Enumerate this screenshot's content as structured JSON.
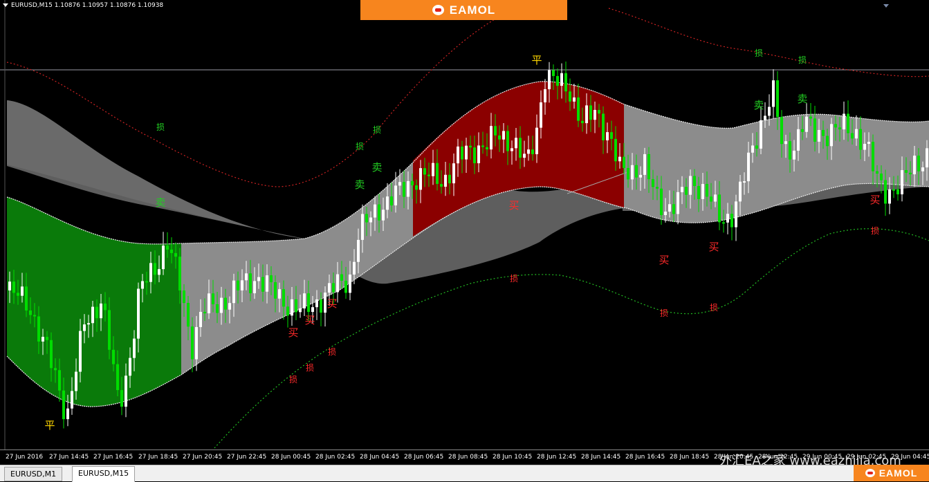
{
  "window": {
    "symbol_title": "EURUSD,M15  1.10876 1.10957 1.10876 1.10938"
  },
  "brand": {
    "banner_text": "EAMOL",
    "banner_color": "#f7851e",
    "footer_text": "EAMOL"
  },
  "watermark": "外汇EA之家  www.eazhijia.com",
  "tabs": [
    {
      "label": "EURUSD,M1",
      "active": false
    },
    {
      "label": "EURUSD,M15",
      "active": true
    }
  ],
  "time_axis": [
    "27 Jun 2016",
    "27 Jun 14:45",
    "27 Jun 16:45",
    "27 Jun 18:45",
    "27 Jun 20:45",
    "27 Jun 22:45",
    "28 Jun 00:45",
    "28 Jun 02:45",
    "28 Jun 04:45",
    "28 Jun 06:45",
    "28 Jun 08:45",
    "28 Jun 10:45",
    "28 Jun 12:45",
    "28 Jun 14:45",
    "28 Jun 16:45",
    "28 Jun 18:45",
    "28 Jun 20:45",
    "28 Jun 22:45",
    "29 Jun 00:45",
    "29 Jun 02:45",
    "29 Jun 04:45"
  ],
  "colors": {
    "background": "#000000",
    "candle_up": "#ffffff",
    "candle_down": "#00dd00",
    "bull_zone": "#0a7a0a",
    "bear_zone": "#8b0000",
    "band": "#8c8c8c",
    "band_dark": "#5e5e5e",
    "upper_dotted": "#cc2222",
    "lower_dotted": "#22bb22",
    "signal_buy": "#ff2a2a",
    "signal_sell": "#22cc22",
    "signal_close": "#ffd700"
  },
  "signals": [
    {
      "text": "平",
      "type": "close"
    },
    {
      "text": "卖",
      "type": "sell"
    },
    {
      "text": "损",
      "type": "sell"
    },
    {
      "text": "损",
      "type": "sell"
    },
    {
      "text": "损",
      "type": "sell"
    },
    {
      "text": "卖",
      "type": "sell"
    },
    {
      "text": "卖",
      "type": "sell"
    },
    {
      "text": "买",
      "type": "buy"
    },
    {
      "text": "买",
      "type": "buy"
    },
    {
      "text": "买",
      "type": "buy"
    },
    {
      "text": "损",
      "type": "buy"
    },
    {
      "text": "损",
      "type": "buy"
    },
    {
      "text": "损",
      "type": "buy"
    },
    {
      "text": "平",
      "type": "close"
    },
    {
      "text": "买",
      "type": "buy"
    },
    {
      "text": "损",
      "type": "buy"
    },
    {
      "text": "买",
      "type": "buy"
    },
    {
      "text": "损",
      "type": "buy"
    },
    {
      "text": "买",
      "type": "buy"
    },
    {
      "text": "损",
      "type": "buy"
    },
    {
      "text": "卖",
      "type": "sell"
    },
    {
      "text": "损",
      "type": "sell"
    },
    {
      "text": "卖",
      "type": "sell"
    },
    {
      "text": "损",
      "type": "sell"
    },
    {
      "text": "买",
      "type": "buy"
    },
    {
      "text": "损",
      "type": "buy"
    }
  ]
}
